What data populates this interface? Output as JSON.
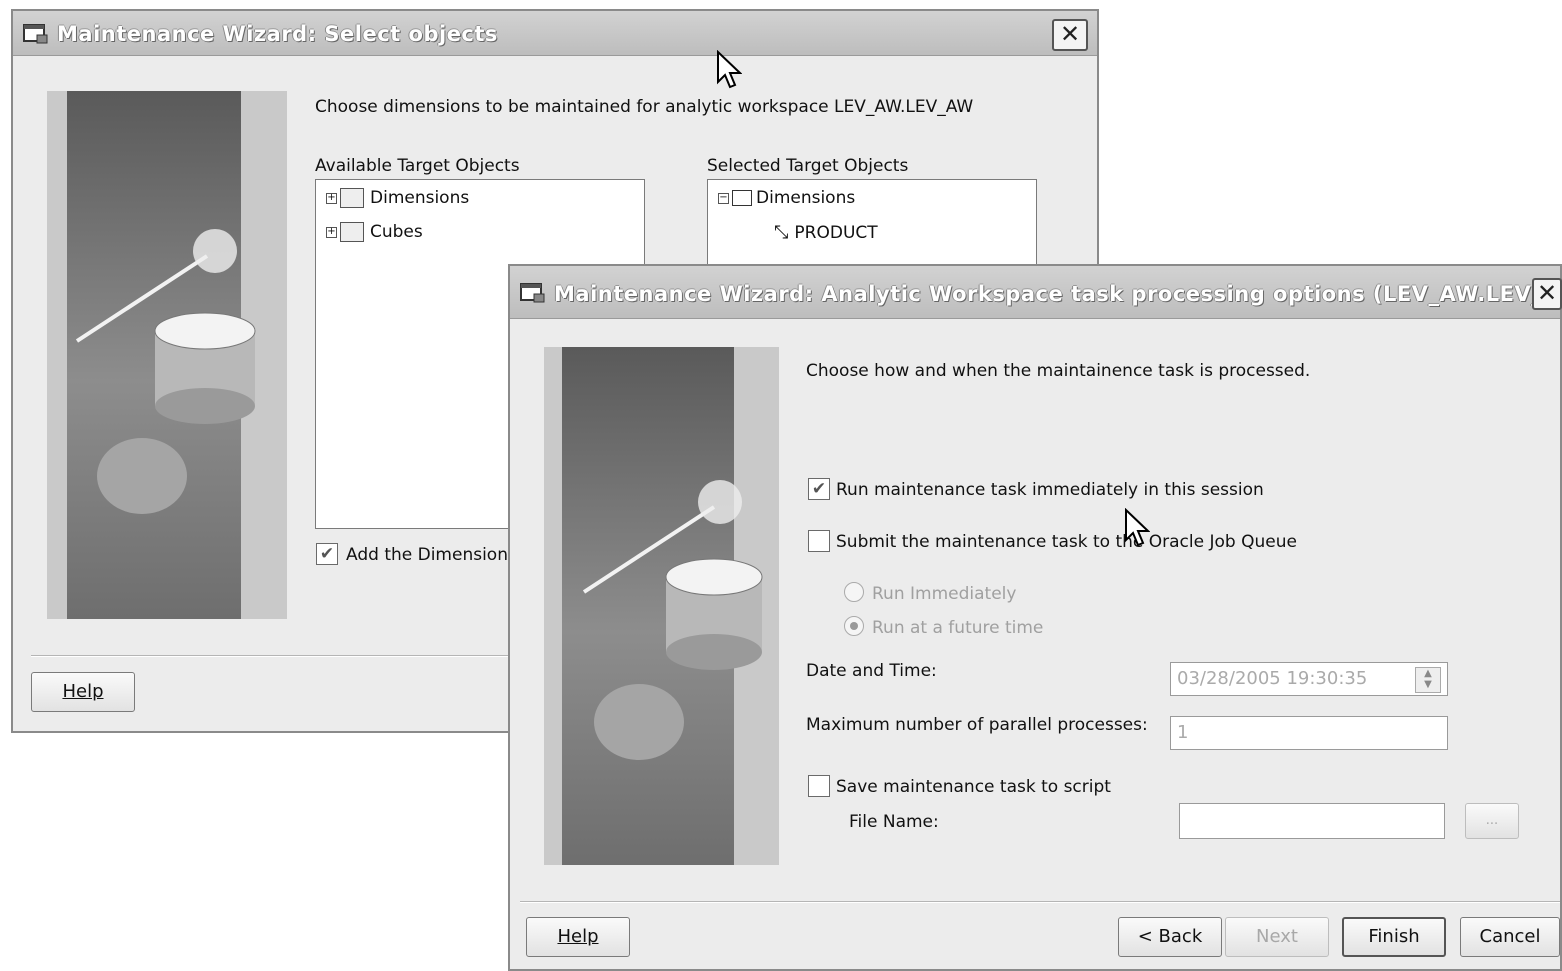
{
  "window1": {
    "title": "Maintenance Wizard: Select objects",
    "instruction": "Choose dimensions to be maintained for analytic workspace LEV_AW.LEV_AW",
    "available_label": "Available Target Objects",
    "available_items": [
      "Dimensions",
      "Cubes"
    ],
    "selected_label": "Selected Target Objects",
    "selected_root": "Dimensions",
    "selected_child": "PRODUCT",
    "add_checkbox_label": "Add the Dimension",
    "help_button": "Help"
  },
  "window2": {
    "title": "Maintenance Wizard: Analytic Workspace task processing options (LEV_AW.LEV_AW)",
    "instruction": "Choose how and when the maintainence task is processed.",
    "run_immediately_session": {
      "label": "Run maintenance task immediately in this session",
      "checked": true
    },
    "submit_job_queue": {
      "label": "Submit the maintenance task to the Oracle Job Queue",
      "checked": false
    },
    "radio_run_immediately": "Run Immediately",
    "radio_run_future": "Run at a future time",
    "date_time_label": "Date and Time:",
    "date_time_value": "03/28/2005 19:30:35",
    "max_parallel_label": "Maximum number of parallel processes:",
    "max_parallel_value": "1",
    "save_script": {
      "label": "Save maintenance task to script",
      "checked": false
    },
    "file_name_label": "File Name:",
    "browse_button": "...",
    "buttons": {
      "help": "Help",
      "back": "< Back",
      "next": "Next",
      "finish": "Finish",
      "cancel": "Cancel"
    }
  }
}
